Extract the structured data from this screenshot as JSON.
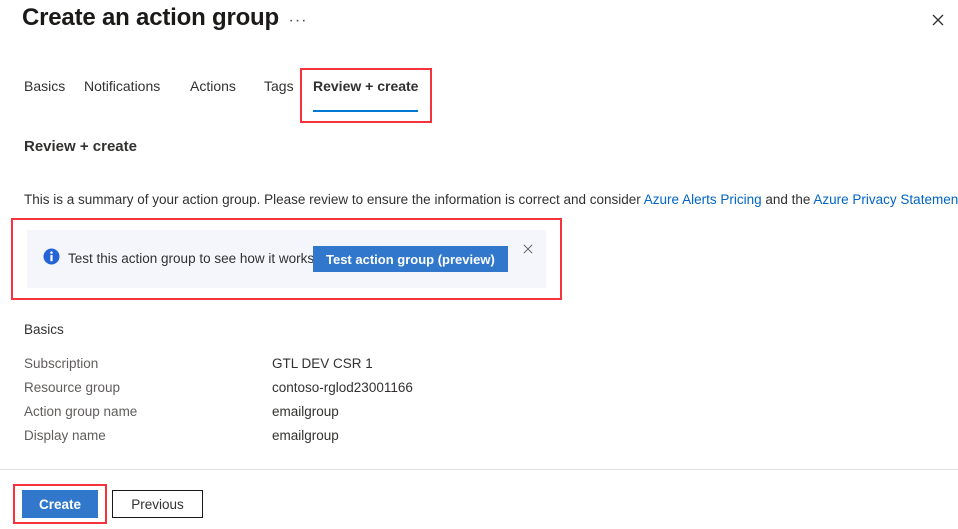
{
  "header": {
    "title": "Create an action group",
    "ellipsis_label": "···",
    "close_label": "Close"
  },
  "tabs": [
    {
      "label": "Basics",
      "active": false
    },
    {
      "label": "Notifications",
      "active": false
    },
    {
      "label": "Actions",
      "active": false
    },
    {
      "label": "Tags",
      "active": false
    },
    {
      "label": "Review + create",
      "active": true
    }
  ],
  "main": {
    "section_heading": "Review + create",
    "description": {
      "part1": "This is a summary of your action group. Please review to ensure the information is correct and consider ",
      "link1": "Azure Alerts Pricing",
      "part2": " and the ",
      "link2": "Azure Privacy Statement",
      "part3": "."
    },
    "banner": {
      "icon": "info-icon",
      "text": "Test this action group to see how it works.",
      "button_label": "Test action group (preview)",
      "close_label": "✕"
    },
    "summary": {
      "heading": "Basics",
      "rows": [
        {
          "label": "Subscription",
          "value": "GTL DEV CSR 1"
        },
        {
          "label": "Resource group",
          "value": "contoso-rglod23001166"
        },
        {
          "label": "Action group name",
          "value": "emailgroup"
        },
        {
          "label": "Display name",
          "value": "emailgroup"
        }
      ]
    }
  },
  "footer": {
    "create_label": "Create",
    "previous_label": "Previous"
  },
  "colors": {
    "accent_blue": "#0078d4",
    "button_blue": "#3178cd",
    "link_blue": "#0064c8",
    "annotation_red": "#f4333d",
    "banner_bg": "#f5f6fc"
  }
}
